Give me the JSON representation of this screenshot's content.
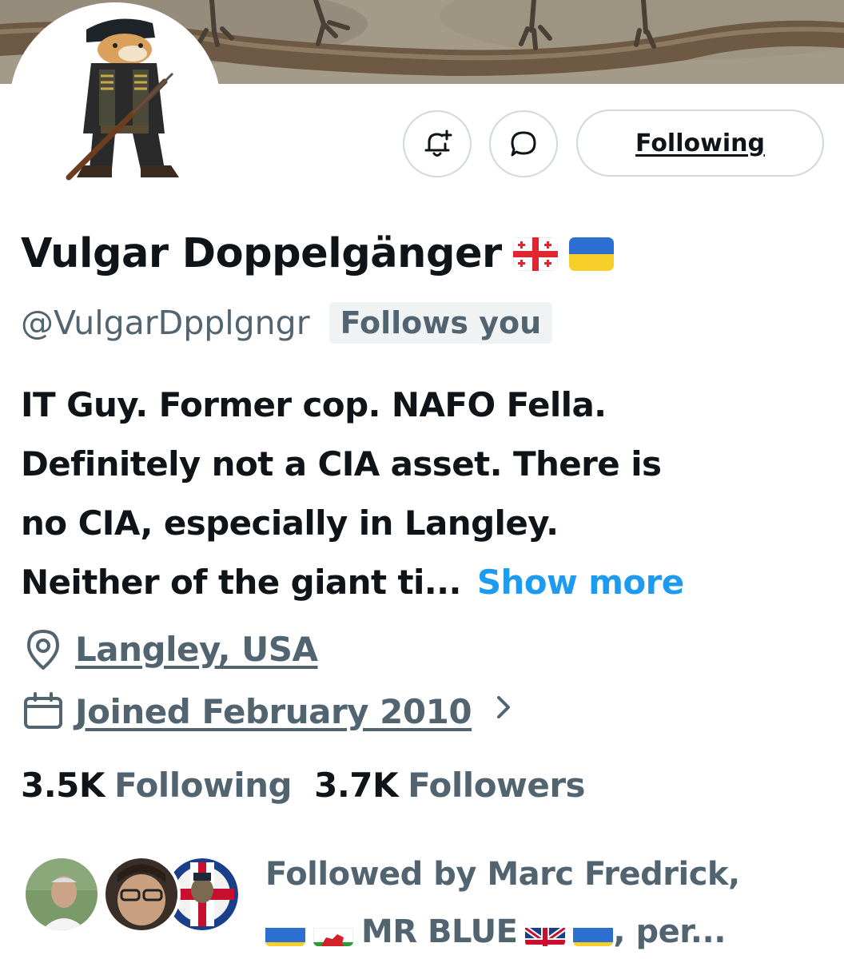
{
  "header": {
    "banner": "branch-banner",
    "avatar": "soldier-doge-avatar"
  },
  "actions": {
    "notify_icon": "bell-plus-icon",
    "message_icon": "chat-bubble-icon",
    "follow_label": "Following"
  },
  "profile": {
    "name": "Vulgar Doppelgänger",
    "flags": [
      "georgia-flag-icon",
      "ukraine-flag-icon"
    ],
    "handle": "@VulgarDpplgngr",
    "follows_you": "Follows you",
    "bio_lines": [
      "IT Guy. Former cop. NAFO Fella.",
      "Definitely not a CIA asset. There is",
      "no CIA, especially in Langley.",
      "Neither of the giant ti..."
    ],
    "show_more": "Show more",
    "location": "Langley, USA",
    "joined": "Joined February 2010"
  },
  "stats": {
    "following_count": "3.5K",
    "following_label": "Following",
    "followers_count": "3.7K",
    "followers_label": "Followers"
  },
  "followed_by": {
    "line1": "Followed by Marc Fredrick,",
    "name2": "MR BLUE",
    "tail": ", per...",
    "flags_before": [
      "ukraine-flag-icon",
      "wales-flag-icon"
    ],
    "flags_after": [
      "uk-flag-icon",
      "ukraine-flag-icon"
    ]
  },
  "colors": {
    "text": "#0f1419",
    "secondary": "#536471",
    "accent": "#1d9bf0",
    "border": "#cfd9de",
    "badge_bg": "#eff3f4"
  }
}
